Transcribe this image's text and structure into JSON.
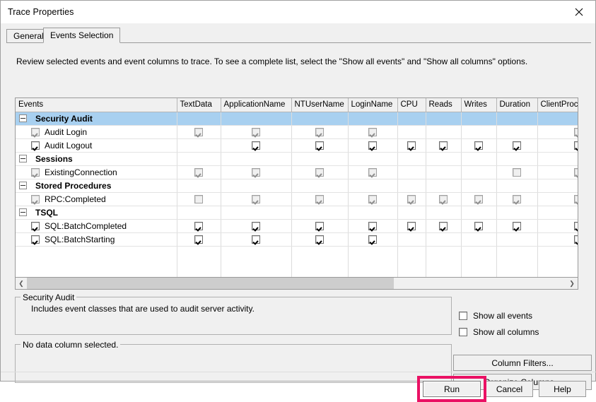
{
  "window": {
    "title": "Trace Properties",
    "close_icon": "close-icon"
  },
  "tabs": [
    {
      "label": "General",
      "active": false
    },
    {
      "label": "Events Selection",
      "active": true
    }
  ],
  "instructions": "Review selected events and event columns to trace. To see a complete list, select the \"Show all events\" and \"Show all columns\" options.",
  "grid": {
    "columns": [
      "Events",
      "TextData",
      "ApplicationName",
      "NTUserName",
      "LoginName",
      "CPU",
      "Reads",
      "Writes",
      "Duration",
      "ClientProcessI"
    ],
    "rows": [
      {
        "type": "category",
        "label": "Security Audit",
        "selected": true,
        "expanded": true,
        "cells": [
          null,
          null,
          null,
          null,
          null,
          null,
          null,
          null,
          null
        ]
      },
      {
        "type": "event",
        "label": "Audit Login",
        "row_checked": true,
        "row_enabled": false,
        "cells": [
          true,
          true,
          true,
          true,
          null,
          null,
          null,
          null,
          true
        ]
      },
      {
        "type": "event",
        "label": "Audit Logout",
        "row_checked": true,
        "row_enabled": true,
        "cells": [
          null,
          true,
          true,
          true,
          true,
          true,
          true,
          true,
          true
        ]
      },
      {
        "type": "category",
        "label": "Sessions",
        "selected": false,
        "expanded": true,
        "cells": [
          null,
          null,
          null,
          null,
          null,
          null,
          null,
          null,
          null
        ]
      },
      {
        "type": "event",
        "label": "ExistingConnection",
        "row_checked": true,
        "row_enabled": false,
        "cells": [
          true,
          true,
          true,
          true,
          null,
          null,
          null,
          false,
          true
        ]
      },
      {
        "type": "category",
        "label": "Stored Procedures",
        "selected": false,
        "expanded": true,
        "cells": [
          null,
          null,
          null,
          null,
          null,
          null,
          null,
          null,
          null
        ]
      },
      {
        "type": "event",
        "label": "RPC:Completed",
        "row_checked": true,
        "row_enabled": false,
        "cells": [
          false,
          true,
          true,
          true,
          true,
          true,
          true,
          true,
          true
        ]
      },
      {
        "type": "category",
        "label": "TSQL",
        "selected": false,
        "expanded": true,
        "cells": [
          null,
          null,
          null,
          null,
          null,
          null,
          null,
          null,
          null
        ]
      },
      {
        "type": "event",
        "label": "SQL:BatchCompleted",
        "row_checked": true,
        "row_enabled": true,
        "cells": [
          true,
          true,
          true,
          true,
          true,
          true,
          true,
          true,
          true
        ]
      },
      {
        "type": "event",
        "label": "SQL:BatchStarting",
        "row_checked": true,
        "row_enabled": true,
        "cells": [
          true,
          true,
          true,
          true,
          null,
          null,
          null,
          null,
          true
        ]
      }
    ]
  },
  "hscroll": {
    "left_arrow": "chevron-left-icon",
    "right_arrow": "chevron-right-icon"
  },
  "description_group": {
    "title": "Security Audit",
    "text": "Includes event classes that are used to audit server activity."
  },
  "column_group": {
    "title": "No data column selected.",
    "text": ""
  },
  "options": [
    {
      "label": "Show all events",
      "checked": false
    },
    {
      "label": "Show all columns",
      "checked": false
    }
  ],
  "buttons": {
    "column_filters": "Column Filters...",
    "organize_columns": "Organize Columns...",
    "run": "Run",
    "cancel": "Cancel",
    "help": "Help"
  },
  "colors": {
    "highlight": "#ea1164",
    "selection": "#a8d0f0"
  }
}
